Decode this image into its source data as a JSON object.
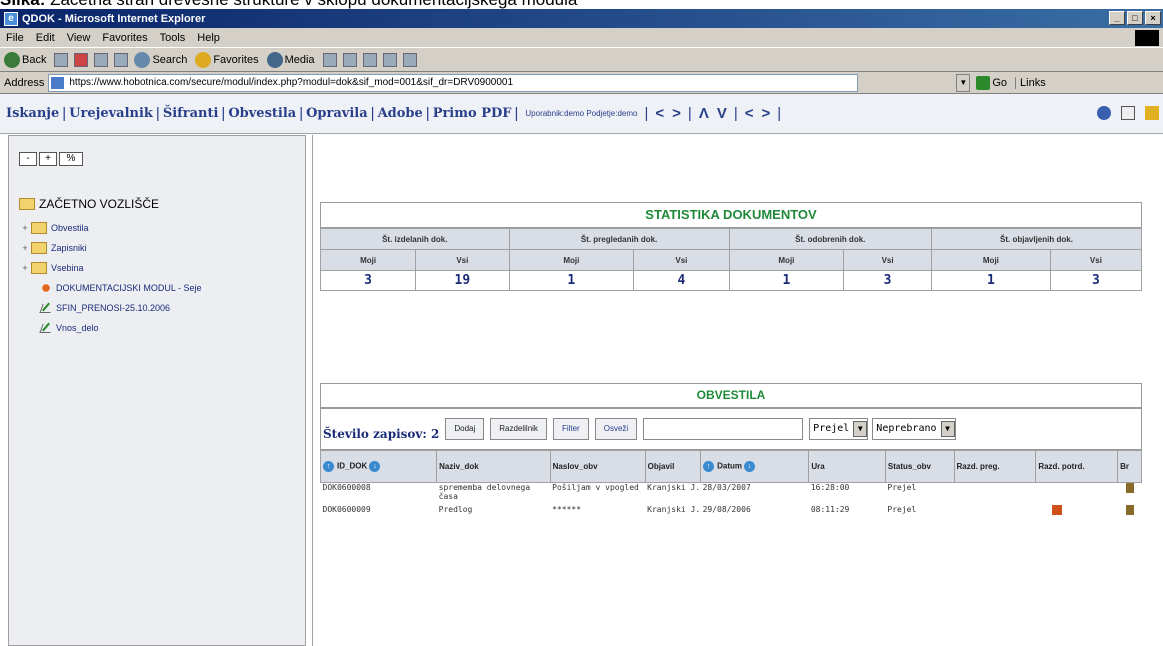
{
  "caption": {
    "label": "Slika:",
    "text": "Začetna stran drevesne strukture v sklopu dokumentacijskega modula"
  },
  "window": {
    "title": "QDOK - Microsoft Internet Explorer"
  },
  "menu": [
    "File",
    "Edit",
    "View",
    "Favorites",
    "Tools",
    "Help"
  ],
  "toolbar": {
    "back": "Back",
    "search": "Search",
    "favorites": "Favorites",
    "media": "Media"
  },
  "address": {
    "label": "Address",
    "url": "https://www.hobotnica.com/secure/modul/index.php?modul=dok&sif_mod=001&sif_dr=DRV0900001",
    "go": "Go",
    "links": "Links"
  },
  "appnav": {
    "items": [
      "Iskanje",
      "Urejevalnik",
      "Šifranti",
      "Obvestila",
      "Opravila",
      "Adobe",
      "Primo PDF"
    ],
    "user": "Uporabnik:demo Podjetje:demo"
  },
  "tree": {
    "buttons": [
      "-",
      "+",
      "%"
    ],
    "root": "ZAČETNO VOZLIŠČE",
    "folders": [
      "Obvestila",
      "Zapisniki",
      "Vsebina"
    ],
    "items": [
      "DOKUMENTACIJSKI MODUL - Seje",
      "SFIN_PRENOSI-25.10.2006",
      "Vnos_delo"
    ]
  },
  "stats": {
    "title": "STATISTIKA DOKUMENTOV",
    "groups": [
      "Št. izdelanih dok.",
      "Št. pregledanih dok.",
      "Št. odobrenih dok.",
      "Št. objavljenih dok."
    ],
    "sub": [
      "Moji",
      "Vsi"
    ],
    "values": [
      "3",
      "19",
      "1",
      "4",
      "1",
      "3",
      "1",
      "3"
    ]
  },
  "obvestila": {
    "title": "OBVESTILA",
    "count_label": "Število zapisov: 2",
    "buttons": {
      "add": "Dodaj",
      "recipients": "Razdelilnik",
      "filter": "Filter",
      "refresh": "Osveži"
    },
    "select_status": "Prejel",
    "select_read": "Neprebrano",
    "columns": [
      "ID_DOK",
      "Naziv_dok",
      "Naslov_obv",
      "Objavil",
      "Datum",
      "Ura",
      "Status_obv",
      "Razd. preg.",
      "Razd. potrd.",
      "Br"
    ],
    "rows": [
      {
        "id": "DOK0600008",
        "naziv": "sprememba delovnega časa",
        "naslov": "Pošiljam v vpogled",
        "objavil": "Kranjski J.",
        "datum": "28/03/2007",
        "ura": "16:28:00",
        "status": "Prejel"
      },
      {
        "id": "DOK0600009",
        "naziv": "Predlog",
        "naslov": "******",
        "objavil": "Kranjski J.",
        "datum": "29/08/2006",
        "ura": "08:11:29",
        "status": "Prejel"
      }
    ]
  }
}
